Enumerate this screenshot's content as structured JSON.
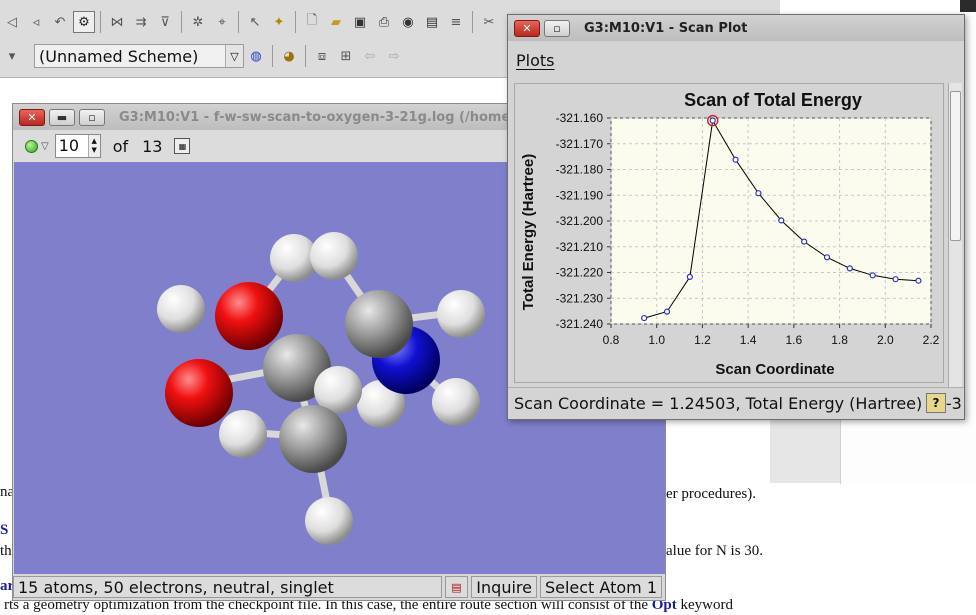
{
  "main_toolbar": {
    "scheme_value": "(Unnamed Scheme)"
  },
  "document": {
    "line1_right": "er procedures).",
    "line2_right": "alue for N is 30.",
    "line3": "rts a geometry optimization from the checkpoint file. In this case, the entire route section will consist of the",
    "line3_bold": "Opt",
    "line3_end": "keyword",
    "frag_na": "na",
    "frag_s": "S",
    "frag_th": "th",
    "frag_ar": "ar"
  },
  "molecule_window": {
    "title": "G3:M10:V1 - f-w-sw-scan-to-oxygen-3-21g.log (/home/v",
    "frame_value": "10",
    "of_label": "of",
    "total_frames": "13",
    "status_text": "15 atoms, 50 electrons, neutral, singlet",
    "inquire_label": "Inquire",
    "select_label": "Select Atom 1"
  },
  "scan_window": {
    "title": "G3:M10:V1 - Scan Plot",
    "menu_plots": "Plots",
    "status_text": "Scan Coordinate = 1.24503, Total Energy (Hartree) = -3"
  },
  "chart_data": {
    "type": "line",
    "title": "Scan of Total Energy",
    "xlabel": "Scan Coordinate",
    "ylabel": "Total Energy (Hartree)",
    "xlim": [
      0.8,
      2.2
    ],
    "ylim": [
      -321.24,
      -321.16
    ],
    "x_ticks": [
      "0.8",
      "1.0",
      "1.2",
      "1.4",
      "1.6",
      "1.8",
      "2.0",
      "2.2"
    ],
    "y_ticks": [
      "-321.160",
      "-321.170",
      "-321.180",
      "-321.190",
      "-321.200",
      "-321.210",
      "-321.220",
      "-321.230",
      "-321.240"
    ],
    "x": [
      0.945,
      1.045,
      1.145,
      1.245,
      1.345,
      1.445,
      1.545,
      1.645,
      1.745,
      1.845,
      1.945,
      2.045,
      2.145
    ],
    "y": [
      -321.2377,
      -321.2352,
      -321.2217,
      -321.161,
      -321.1762,
      -321.1892,
      -321.1998,
      -321.208,
      -321.2141,
      -321.2184,
      -321.2211,
      -321.2226,
      -321.2232
    ],
    "selected_index": 3,
    "grid": true,
    "colors": {
      "line": "#000000",
      "marker": "#3030c0",
      "selected": "#d02020",
      "plot_bg": "#fbfbee",
      "grid": "#c8c8c8"
    }
  }
}
